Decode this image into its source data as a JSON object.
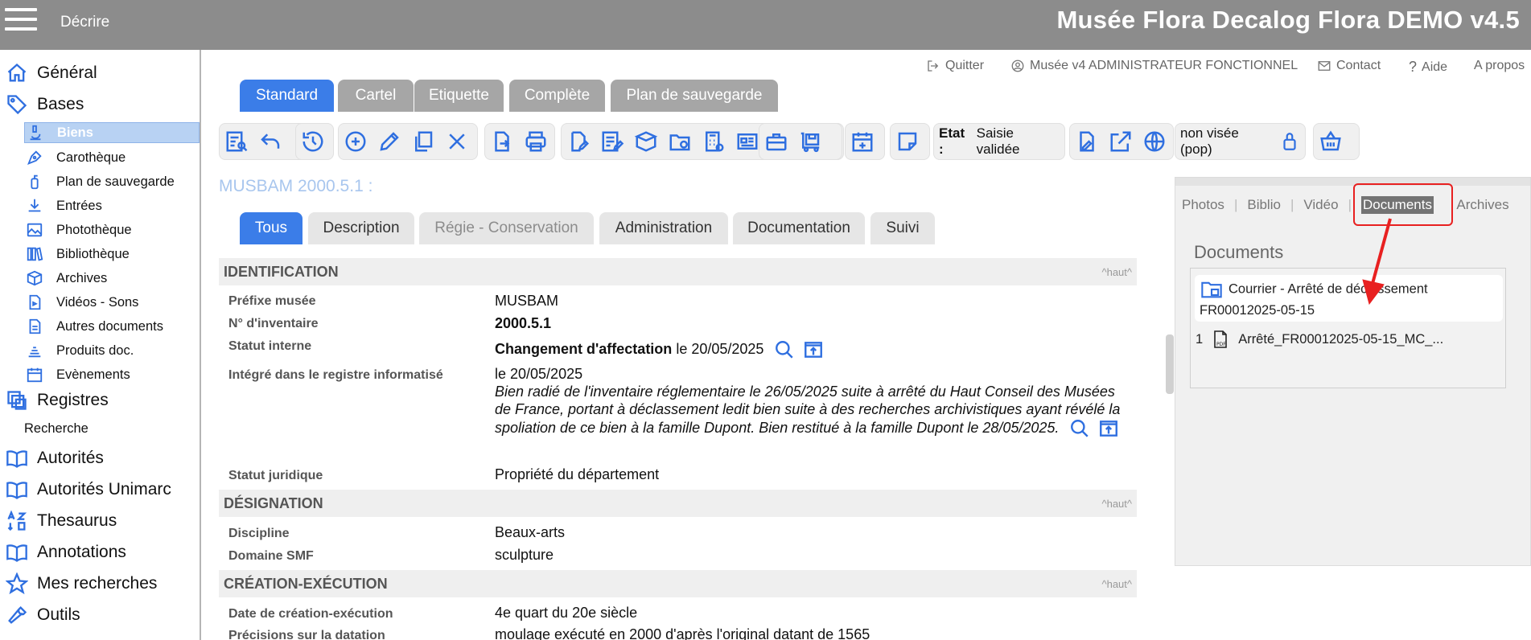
{
  "topbar": {
    "section": "Décrire",
    "app_title": "Musée Flora Decalog Flora DEMO v4.5"
  },
  "sidebar": {
    "general": "Général",
    "bases": "Bases",
    "bases_items": [
      "Biens",
      "Carothèque",
      "Plan de sauvegarde",
      "Entrées",
      "Photothèque",
      "Bibliothèque",
      "Archives",
      "Vidéos - Sons",
      "Autres documents",
      "Produits doc.",
      "Evènements"
    ],
    "registres": "Registres",
    "recherche": "Recherche",
    "autorites": "Autorités",
    "autorites_unimarc": "Autorités Unimarc",
    "thesaurus": "Thesaurus",
    "annotations": "Annotations",
    "mes_recherches": "Mes recherches",
    "outils": "Outils"
  },
  "utility": {
    "quitter": "Quitter",
    "user": "Musée v4 ADMINISTRATEUR FONCTIONNEL",
    "contact": "Contact",
    "aide": "Aide",
    "apropos": "A propos"
  },
  "tabs": [
    "Standard",
    "Cartel",
    "Etiquette",
    "Complète",
    "Plan de sauvegarde"
  ],
  "toolbar": {
    "etat_label": "Etat :",
    "etat_value": "Saisie validée",
    "visee": "non visée (pop)"
  },
  "record": {
    "ref": "MUSBAM 2000.5.1 :"
  },
  "subtabs": [
    "Tous",
    "Description",
    "Régie - Conservation",
    "Administration",
    "Documentation",
    "Suivi"
  ],
  "sections": {
    "haut": "^haut^",
    "identification": "IDENTIFICATION",
    "designation": "DÉSIGNATION",
    "creation": "CRÉATION-EXÉCUTION"
  },
  "fields": {
    "prefixe_label": "Préfixe musée",
    "prefixe_value": "MUSBAM",
    "inv_label": "N° d'inventaire",
    "inv_value": "2000.5.1",
    "statut_label": "Statut interne",
    "statut_value": "Changement d'affectation",
    "statut_date": "le 20/05/2025",
    "integre_label": "Intégré dans le registre informatisé",
    "integre_date": "le 20/05/2025",
    "integre_note": "Bien radié de l'inventaire réglementaire le 26/05/2025 suite à arrêté du Haut Conseil des Musées de France, portant à déclassement ledit bien suite à des recherches archivistiques ayant révélé la spoliation de ce bien à la famille Dupont. Bien restitué à la famille Dupont le 28/05/2025.",
    "juridique_label": "Statut juridique",
    "juridique_value": "Propriété du département",
    "discipline_label": "Discipline",
    "discipline_value": "Beaux-arts",
    "domaine_label": "Domaine SMF",
    "domaine_value": "sculpture",
    "date_label": "Date de création-exécution",
    "date_value": "4e quart du 20e siècle",
    "precisions_label": "Précisions sur la datation",
    "precisions_value": "moulage exécuté en 2000 d'après l'original datant de 1565"
  },
  "right_panel": {
    "tabs": [
      "Photos",
      "Biblio",
      "Vidéo",
      "Documents",
      "Archives"
    ],
    "title": "Documents",
    "doc1_line1": "Courrier - Arrêté de déclassement",
    "doc1_line2": "FR00012025-05-15",
    "doc2_num": "1",
    "doc2_name": "Arrêté_FR00012025-05-15_MC_..."
  }
}
